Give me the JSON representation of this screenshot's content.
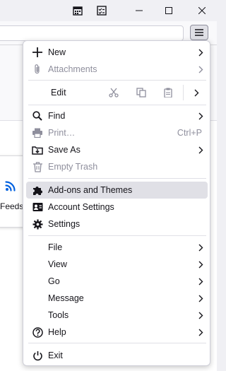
{
  "menu": {
    "items_top": [
      {
        "label": "New",
        "icon": "plus-icon",
        "submenu": true,
        "disabled": false
      },
      {
        "label": "Attachments",
        "icon": "paperclip-icon",
        "submenu": true,
        "disabled": true
      }
    ],
    "edit": {
      "label": "Edit",
      "cut_icon": "scissors-icon",
      "copy_icon": "copy-icon",
      "paste_icon": "clipboard-icon"
    },
    "items_mid": [
      {
        "label": "Find",
        "icon": "search-icon",
        "submenu": true,
        "disabled": false
      },
      {
        "label": "Print…",
        "icon": "printer-icon",
        "shortcut": "Ctrl+P",
        "disabled": true
      },
      {
        "label": "Save As",
        "icon": "save-as-icon",
        "submenu": true,
        "disabled": false
      },
      {
        "label": "Empty Trash",
        "icon": "trash-icon",
        "disabled": true
      }
    ],
    "items_addons": [
      {
        "label": "Add-ons and Themes",
        "icon": "puzzle-icon",
        "hovered": true
      },
      {
        "label": "Account Settings",
        "icon": "account-icon"
      },
      {
        "label": "Settings",
        "icon": "gear-icon"
      }
    ],
    "items_sub": [
      {
        "label": "File"
      },
      {
        "label": "View"
      },
      {
        "label": "Go"
      },
      {
        "label": "Message"
      },
      {
        "label": "Tools"
      }
    ],
    "help": {
      "label": "Help",
      "icon": "help-icon"
    },
    "exit": {
      "label": "Exit",
      "icon": "power-icon"
    }
  },
  "background": {
    "feeds_label": "Feeds",
    "feed_icon": "rss-icon"
  },
  "colors": {
    "hover": "#e0e0e6",
    "disabled": "#8f8f9d",
    "rss": "#0060df"
  }
}
